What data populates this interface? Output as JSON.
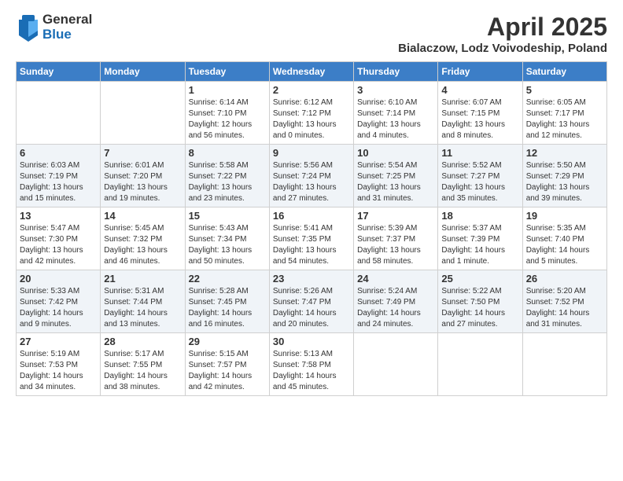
{
  "logo": {
    "general": "General",
    "blue": "Blue"
  },
  "header": {
    "month": "April 2025",
    "location": "Bialaczow, Lodz Voivodeship, Poland"
  },
  "weekdays": [
    "Sunday",
    "Monday",
    "Tuesday",
    "Wednesday",
    "Thursday",
    "Friday",
    "Saturday"
  ],
  "weeks": [
    [
      {
        "day": "",
        "info": ""
      },
      {
        "day": "",
        "info": ""
      },
      {
        "day": "1",
        "info": "Sunrise: 6:14 AM\nSunset: 7:10 PM\nDaylight: 12 hours and 56 minutes."
      },
      {
        "day": "2",
        "info": "Sunrise: 6:12 AM\nSunset: 7:12 PM\nDaylight: 13 hours and 0 minutes."
      },
      {
        "day": "3",
        "info": "Sunrise: 6:10 AM\nSunset: 7:14 PM\nDaylight: 13 hours and 4 minutes."
      },
      {
        "day": "4",
        "info": "Sunrise: 6:07 AM\nSunset: 7:15 PM\nDaylight: 13 hours and 8 minutes."
      },
      {
        "day": "5",
        "info": "Sunrise: 6:05 AM\nSunset: 7:17 PM\nDaylight: 13 hours and 12 minutes."
      }
    ],
    [
      {
        "day": "6",
        "info": "Sunrise: 6:03 AM\nSunset: 7:19 PM\nDaylight: 13 hours and 15 minutes."
      },
      {
        "day": "7",
        "info": "Sunrise: 6:01 AM\nSunset: 7:20 PM\nDaylight: 13 hours and 19 minutes."
      },
      {
        "day": "8",
        "info": "Sunrise: 5:58 AM\nSunset: 7:22 PM\nDaylight: 13 hours and 23 minutes."
      },
      {
        "day": "9",
        "info": "Sunrise: 5:56 AM\nSunset: 7:24 PM\nDaylight: 13 hours and 27 minutes."
      },
      {
        "day": "10",
        "info": "Sunrise: 5:54 AM\nSunset: 7:25 PM\nDaylight: 13 hours and 31 minutes."
      },
      {
        "day": "11",
        "info": "Sunrise: 5:52 AM\nSunset: 7:27 PM\nDaylight: 13 hours and 35 minutes."
      },
      {
        "day": "12",
        "info": "Sunrise: 5:50 AM\nSunset: 7:29 PM\nDaylight: 13 hours and 39 minutes."
      }
    ],
    [
      {
        "day": "13",
        "info": "Sunrise: 5:47 AM\nSunset: 7:30 PM\nDaylight: 13 hours and 42 minutes."
      },
      {
        "day": "14",
        "info": "Sunrise: 5:45 AM\nSunset: 7:32 PM\nDaylight: 13 hours and 46 minutes."
      },
      {
        "day": "15",
        "info": "Sunrise: 5:43 AM\nSunset: 7:34 PM\nDaylight: 13 hours and 50 minutes."
      },
      {
        "day": "16",
        "info": "Sunrise: 5:41 AM\nSunset: 7:35 PM\nDaylight: 13 hours and 54 minutes."
      },
      {
        "day": "17",
        "info": "Sunrise: 5:39 AM\nSunset: 7:37 PM\nDaylight: 13 hours and 58 minutes."
      },
      {
        "day": "18",
        "info": "Sunrise: 5:37 AM\nSunset: 7:39 PM\nDaylight: 14 hours and 1 minute."
      },
      {
        "day": "19",
        "info": "Sunrise: 5:35 AM\nSunset: 7:40 PM\nDaylight: 14 hours and 5 minutes."
      }
    ],
    [
      {
        "day": "20",
        "info": "Sunrise: 5:33 AM\nSunset: 7:42 PM\nDaylight: 14 hours and 9 minutes."
      },
      {
        "day": "21",
        "info": "Sunrise: 5:31 AM\nSunset: 7:44 PM\nDaylight: 14 hours and 13 minutes."
      },
      {
        "day": "22",
        "info": "Sunrise: 5:28 AM\nSunset: 7:45 PM\nDaylight: 14 hours and 16 minutes."
      },
      {
        "day": "23",
        "info": "Sunrise: 5:26 AM\nSunset: 7:47 PM\nDaylight: 14 hours and 20 minutes."
      },
      {
        "day": "24",
        "info": "Sunrise: 5:24 AM\nSunset: 7:49 PM\nDaylight: 14 hours and 24 minutes."
      },
      {
        "day": "25",
        "info": "Sunrise: 5:22 AM\nSunset: 7:50 PM\nDaylight: 14 hours and 27 minutes."
      },
      {
        "day": "26",
        "info": "Sunrise: 5:20 AM\nSunset: 7:52 PM\nDaylight: 14 hours and 31 minutes."
      }
    ],
    [
      {
        "day": "27",
        "info": "Sunrise: 5:19 AM\nSunset: 7:53 PM\nDaylight: 14 hours and 34 minutes."
      },
      {
        "day": "28",
        "info": "Sunrise: 5:17 AM\nSunset: 7:55 PM\nDaylight: 14 hours and 38 minutes."
      },
      {
        "day": "29",
        "info": "Sunrise: 5:15 AM\nSunset: 7:57 PM\nDaylight: 14 hours and 42 minutes."
      },
      {
        "day": "30",
        "info": "Sunrise: 5:13 AM\nSunset: 7:58 PM\nDaylight: 14 hours and 45 minutes."
      },
      {
        "day": "",
        "info": ""
      },
      {
        "day": "",
        "info": ""
      },
      {
        "day": "",
        "info": ""
      }
    ]
  ]
}
